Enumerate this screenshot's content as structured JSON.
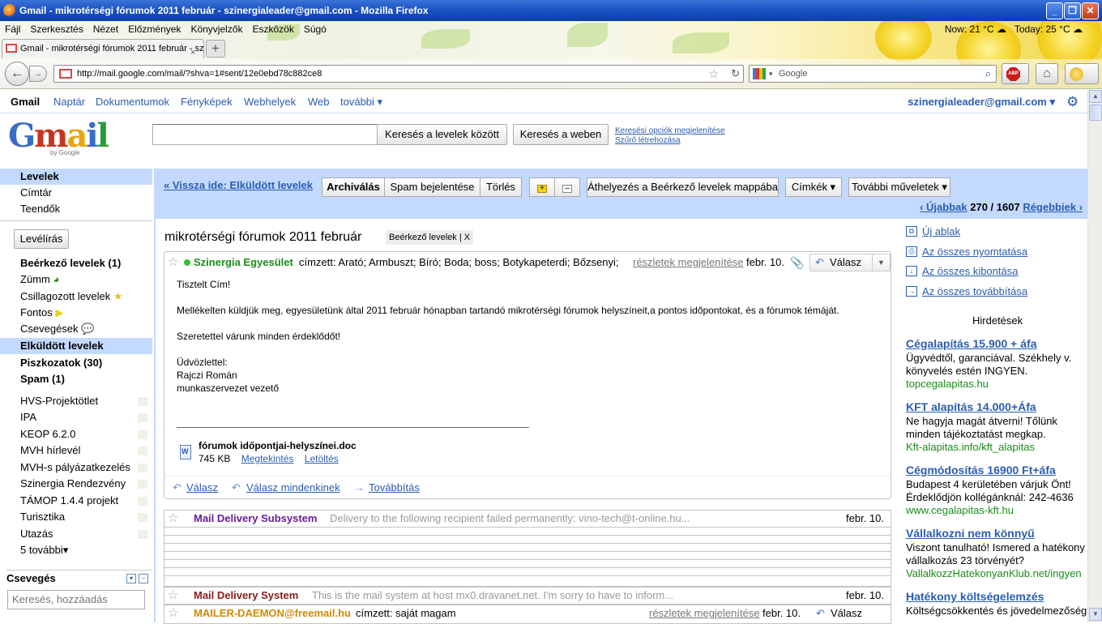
{
  "window": {
    "title": "Gmail - mikrotérségi fórumok 2011 február - szinergialeader@gmail.com - Mozilla Firefox",
    "min": "_",
    "max": "❐",
    "close": "✕"
  },
  "menu": [
    "Fájl",
    "Szerkesztés",
    "Nézet",
    "Előzmények",
    "Könyvjelzők",
    "Eszközök",
    "Súgó"
  ],
  "weather": {
    "now": "Now: 21 °C",
    "today": "Today: 25 °C"
  },
  "tab": {
    "title": "Gmail - mikrotérségi fórumok 2011 február - sz...",
    "close": "×",
    "new": "+"
  },
  "nav": {
    "url": "http://mail.google.com/mail/?shva=1#sent/12e0ebd78c882ce8",
    "search_placeholder": "Google"
  },
  "gbar": {
    "items": [
      "Gmail",
      "Naptár",
      "Dokumentumok",
      "Fényképek",
      "Webhelyek",
      "Web",
      "további ▾"
    ],
    "email": "szinergialeader@gmail.com ▾"
  },
  "header": {
    "logo": "Gmail",
    "logo_by": "by Google",
    "search_mail": "Keresés a levelek között",
    "search_web": "Keresés a weben",
    "search_options": "Keresési opciók megjelenítése",
    "create_filter": "Szűrő létrehozása"
  },
  "leftnav": {
    "top": [
      "Levelek",
      "Címtár",
      "Teendők"
    ],
    "compose": "Levélírás",
    "folders": [
      {
        "label": "Beérkező levelek (1)",
        "bold": true
      },
      {
        "label": "Zümm",
        "bold": false
      },
      {
        "label": "Csillagozott levelek",
        "bold": false
      },
      {
        "label": "Fontos",
        "bold": false
      },
      {
        "label": "Csevegések",
        "bold": false
      },
      {
        "label": "Elküldött levelek",
        "bold": true
      },
      {
        "label": "Piszkozatok (30)",
        "bold": true
      },
      {
        "label": "Spam (1)",
        "bold": true
      }
    ],
    "labels": [
      "HVS-Projektötlet",
      "IPA",
      "KEOP 6.2.0",
      "MVH hírlevél",
      "MVH-s pályázatkezelés",
      "Szinergia Rendezvény",
      "TÁMOP 1.4.4 projekt",
      "Turisztika",
      "Utazás",
      "5 további▾"
    ],
    "chat_title": "Csevegés",
    "chat_placeholder": "Keresés, hozzáadás"
  },
  "toolbar": {
    "back": "« Vissza ide: Elküldött levelek",
    "archive": "Archiválás",
    "spam": "Spam bejelentése",
    "delete": "Törlés",
    "move": "Áthelyezés a Beérkező levelek mappába",
    "labels": "Címkék ▾",
    "more": "További műveletek ▾",
    "newer": "‹ Újabbak",
    "count": "270 / 1607",
    "older": "Régebbiek ›"
  },
  "thread": {
    "subject": "mikrotérségi fórumok 2011 február",
    "label": "Beérkező levelek | X",
    "message": {
      "sender": "Szinergia Egyesület",
      "recipients": "címzett: Arató; Armbuszt; Bíró; Boda; boss; Botykapeterdi; Bőzsenyi;",
      "details": "részletek megjelenítése",
      "date": "febr. 10.",
      "reply": "Válasz",
      "body": [
        "Tisztelt Cím!",
        "Mellékelten küldjük meg, egyesületünk által 2011 február hónapban tartandó mikrotérségi fórumok helyszíneit,a pontos időpontokat, és a fórumok témáját.",
        "Szeretettel várunk minden érdeklődőt!",
        "Üdvözlettel:",
        "Rajczi Román",
        "munkaszervezet vezető"
      ],
      "attachment": {
        "name": "fórumok időpontjai-helyszínei.doc",
        "size": "745 KB",
        "view": "Megtekintés",
        "download": "Letöltés"
      },
      "foot_reply": "Válasz",
      "foot_reply_all": "Válasz mindenkinek",
      "foot_forward": "Továbbítás"
    },
    "collapsed": [
      {
        "sender": "Mail Delivery Subsystem",
        "snippet": "Delivery to the following recipient failed permanently: vino-tech@t-online.hu...",
        "date": "febr. 10.",
        "color": "#6a1b9a"
      },
      {
        "sender": "Mail Delivery System",
        "snippet": "This is the mail system at host mx0.dravanet.net. I'm sorry to have to inform...",
        "date": "febr. 10.",
        "color": "#8b1a1a"
      },
      {
        "sender": "MAILER-DAEMON@freemail.hu",
        "snippet": "címzett: saját magam",
        "date": "febr. 10.",
        "details": "részletek megjelenítése",
        "reply": "Válasz",
        "color": "#d08a00"
      }
    ]
  },
  "rightcol": {
    "actions": [
      "Új ablak",
      "Az összes nyomtatása",
      "Az összes kibontása",
      "Az összes továbbítása"
    ],
    "ads_title": "Hirdetések",
    "ads": [
      {
        "title": "Cégalapítás 15.900 + áfa",
        "text": "Ügyvédtől, garanciával. Székhely v. könyvelés estén INGYEN.",
        "url": "topcegalapitas.hu"
      },
      {
        "title": "KFT alapítás 14.000+Áfa",
        "text": "Ne hagyja magát átverni! Tőlünk minden tájékoztatást megkap.",
        "url": "Kft-alapitas.info/kft_alapitas"
      },
      {
        "title": "Cégmódosítás 16900 Ft+áfa",
        "text": "Budapest 4 kerületében várjuk Önt! Érdeklődjön kollégánknál: 242-4636",
        "url": "www.cegalapitas-kft.hu"
      },
      {
        "title": "Vállalkozni nem könnyű",
        "text": "Viszont tanulható! Ismered a hatékony vállalkozás 23 törvényét?",
        "url": "VallalkozzHatekonyanKlub.net/ingyen"
      },
      {
        "title": "Hatékony költségelemzés",
        "text": "Költségcsökkentés és jövedelmezőség",
        "url": ""
      }
    ]
  }
}
